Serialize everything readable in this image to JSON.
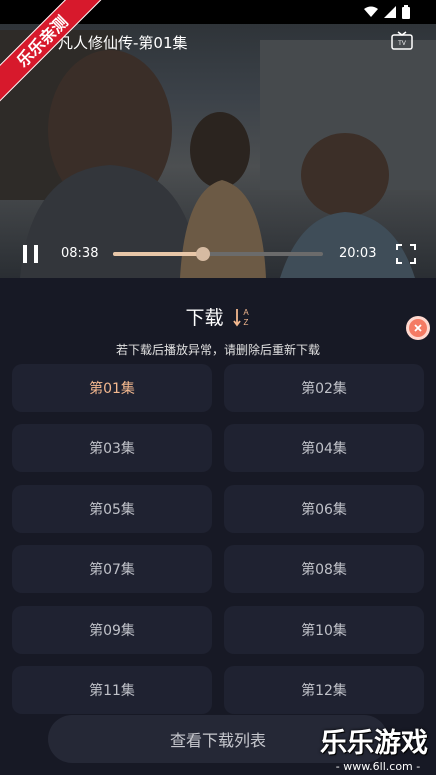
{
  "player": {
    "title": "凡人修仙传-第01集",
    "current_time": "08:38",
    "total_time": "20:03",
    "progress": 0.43
  },
  "watermark": {
    "ribbon_text": "乐乐亲测"
  },
  "panel": {
    "title": "下载",
    "hint": "若下载后播放异常，请删除后重新下载",
    "episodes": [
      "第01集",
      "第02集",
      "第03集",
      "第04集",
      "第05集",
      "第06集",
      "第07集",
      "第08集",
      "第09集",
      "第10集",
      "第11集",
      "第12集"
    ],
    "selected_index": 0,
    "view_list_label": "查看下载列表"
  },
  "site_logo": {
    "brand": "乐乐游戏",
    "url": "- www.6ll.com -"
  },
  "colors": {
    "accent": "#f3b88f",
    "close": "#f47b64",
    "panel_bg": "#171925",
    "tile_bg": "#1f2231"
  },
  "icons": [
    "pause-icon",
    "tv-cast-icon",
    "fullscreen-icon",
    "sort-az-icon",
    "close-icon",
    "wifi-icon",
    "signal-icon",
    "battery-icon"
  ]
}
